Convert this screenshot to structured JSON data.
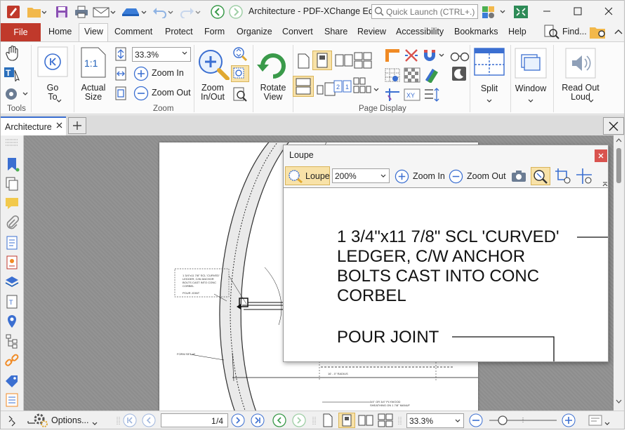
{
  "window": {
    "title": "Architecture - PDF-XChange Ed...",
    "quick_launch_placeholder": "Quick Launch (CTRL+.)"
  },
  "menu": {
    "file": "File",
    "tabs": [
      "Home",
      "View",
      "Comment",
      "Protect",
      "Form",
      "Organize",
      "Convert",
      "Share",
      "Review",
      "Accessibility",
      "Bookmarks",
      "Help"
    ],
    "active_tab": "View",
    "find": "Find..."
  },
  "ribbon": {
    "tools_group": "Tools",
    "go_to": "Go\nTo",
    "actual_size": "Actual\nSize",
    "zoom_value": "33.3%",
    "zoom_in": "Zoom In",
    "zoom_out": "Zoom Out",
    "zoom_in_out": "Zoom\nIn/Out",
    "zoom_group": "Zoom",
    "rotate_view": "Rotate\nView",
    "page_display_group": "Page Display",
    "split": "Split",
    "window": "Window",
    "read_out_loud": "Read Out\nLoud"
  },
  "doc_tab": {
    "label": "Architecture"
  },
  "loupe": {
    "title": "Loupe",
    "loupe_button": "Loupe",
    "zoom_value": "200%",
    "zoom_in": "Zoom In",
    "zoom_out": "Zoom Out",
    "magnified_lines": [
      "1 3/4\"x11 7/8\" SCL 'CURVED'",
      "LEDGER, C/W ANCHOR",
      "BOLTS CAST INTO CONC",
      "CORBEL"
    ],
    "pour_joint": "POUR JOINT"
  },
  "drawing": {
    "note_lines": [
      "1 3/4\"x11 7/8\" SCL 'CURVED'",
      "LEDGER, C/W ANCHOR",
      "BOLTS CAST INTO CONC",
      "CORBEL"
    ],
    "pour_joint": "POUR JOINT",
    "form_set": "FORM SET #2",
    "radius": "16' - 0\" RADIUS",
    "plywood_lines": [
      "3/4\" OR 3/4\" PLYWOOD",
      "SHEATHING ON 1 7/8\" MANUF"
    ]
  },
  "status": {
    "options": "Options...",
    "page_current": "1",
    "page_total": "/4",
    "zoom_value": "33.3%"
  },
  "colors": {
    "file_tab": "#c0392b",
    "accent": "#3b6fd1",
    "loupe_active": "#f8e2a8"
  }
}
